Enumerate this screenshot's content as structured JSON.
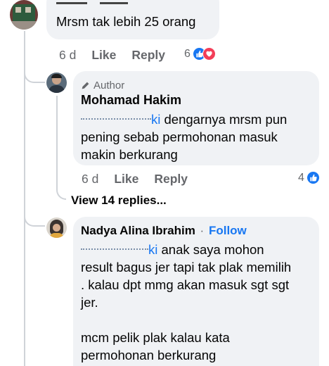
{
  "comments": [
    {
      "author_visible": "",
      "text": "Mrsm tak lebih 25 orang",
      "time": "6 d",
      "like_label": "Like",
      "reply_label": "Reply",
      "reaction_count": "6"
    },
    {
      "badge": "Author",
      "author": "Mohamad Hakim",
      "mention_tail": "ki",
      "text": "dengarnya mrsm pun pening sebab permohonan masuk makin berkurang",
      "time": "6 d",
      "like_label": "Like",
      "reply_label": "Reply",
      "reaction_count": "4"
    },
    {
      "author": "Nadya Alina Ibrahim",
      "separator": "·",
      "follow_label": "Follow",
      "mention_tail": "ki",
      "text_line1": "anak saya mohon",
      "text_rest": "result bagus jer tapi tak plak memilih . kalau dpt mmg akan masuk sgt sgt jer.",
      "text_para2": "mcm pelik plak kalau kata permohonan berkurang"
    }
  ],
  "view_replies_label": "View 14 replies...",
  "colors": {
    "link": "#1877f2",
    "bubble": "#f0f2f5",
    "meta": "#65676b",
    "love": "#f33e58"
  },
  "icons": [
    "pencil-icon",
    "like-reaction-icon",
    "love-reaction-icon"
  ]
}
